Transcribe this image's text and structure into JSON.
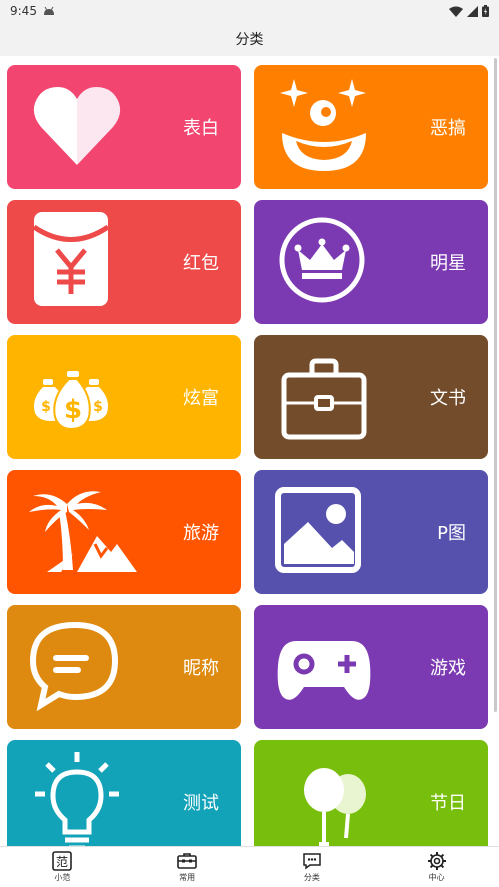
{
  "status": {
    "time": "9:45"
  },
  "header": {
    "title": "分类"
  },
  "tiles": [
    {
      "label": "表白",
      "color": "#F2456F",
      "icon": "heart-icon"
    },
    {
      "label": "恶搞",
      "color": "#FF8000",
      "icon": "clown-face-icon"
    },
    {
      "label": "红包",
      "color": "#EE4A4A",
      "icon": "red-envelope-icon"
    },
    {
      "label": "明星",
      "color": "#7B3AB2",
      "icon": "crown-icon"
    },
    {
      "label": "炫富",
      "color": "#FFB400",
      "icon": "money-bags-icon"
    },
    {
      "label": "文书",
      "color": "#734C2B",
      "icon": "briefcase-icon"
    },
    {
      "label": "旅游",
      "color": "#FF5500",
      "icon": "palm-tree-icon"
    },
    {
      "label": "P图",
      "color": "#5551AD",
      "icon": "image-icon"
    },
    {
      "label": "昵称",
      "color": "#DE8A10",
      "icon": "speech-bubble-icon"
    },
    {
      "label": "游戏",
      "color": "#7B3AB2",
      "icon": "gamepad-icon"
    },
    {
      "label": "测试",
      "color": "#12A3B8",
      "icon": "lightbulb-icon"
    },
    {
      "label": "节日",
      "color": "#78BE0C",
      "icon": "balloons-icon"
    }
  ],
  "tabs": [
    {
      "label": "小范",
      "icon": "fan-logo-icon"
    },
    {
      "label": "常用",
      "icon": "toolbox-icon"
    },
    {
      "label": "分类",
      "icon": "category-icon"
    },
    {
      "label": "中心",
      "icon": "gear-icon"
    }
  ]
}
